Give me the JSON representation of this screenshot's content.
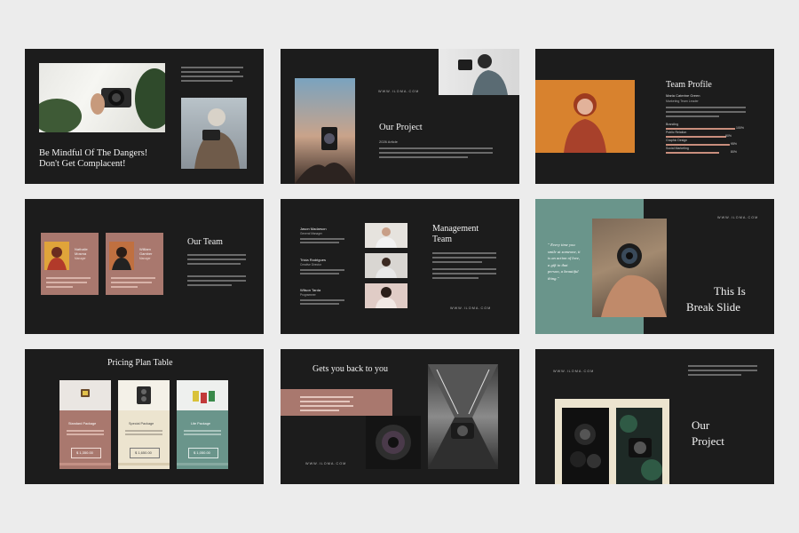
{
  "slides": {
    "s1": {
      "title_line1": "Be Mindful Of The Dangers!",
      "title_line2": "Don't Get Complacent!"
    },
    "s2": {
      "website": "WWW.ILOMA.COM",
      "title": "Our Project",
      "subtitle": "2026 Article"
    },
    "s3": {
      "title": "Team Profile",
      "name": "Maria Caterine Green",
      "role": "Marketing Team Leader",
      "skills": [
        {
          "label": "Branding",
          "percent": "100%",
          "value": 1.0
        },
        {
          "label": "Public Relation",
          "percent": "90%",
          "value": 0.9
        },
        {
          "label": "Graphic Design",
          "percent": "95%",
          "value": 0.95
        },
        {
          "label": "Social Marketing",
          "percent": "80%",
          "value": 0.8
        }
      ]
    },
    "s4": {
      "title": "Our Team",
      "members": [
        {
          "name_line1": "Nathalie",
          "name_line2": "Mosma",
          "role": "Manager"
        },
        {
          "name_line1": "William",
          "name_line2": "Gamber",
          "role": "Manager"
        }
      ]
    },
    "s5": {
      "title_line1": "Management",
      "title_line2": "Team",
      "website": "WWW.ILOMA.COM",
      "members": [
        {
          "name": "Jason Madarson",
          "role": "General Manager"
        },
        {
          "name": "Tricia Rodrigues",
          "role": "Creative Director"
        },
        {
          "name": "Wilson Tarda",
          "role": "Programmer"
        }
      ]
    },
    "s6": {
      "website": "WWW.ILOMA.COM",
      "quote": [
        "\" Every time you",
        "smile at someone, it",
        "is an action of love,",
        "a gift to that",
        "person, a beautiful",
        "thing.\""
      ],
      "title_line1": "This Is",
      "title_line2": "Break Slide"
    },
    "s7": {
      "title": "Pricing Plan Table",
      "plans": [
        {
          "name": "Standard Package",
          "price": "$ 1,350.00"
        },
        {
          "name": "Special Package",
          "price": "$ 1,650.00"
        },
        {
          "name": "Lite Package",
          "price": "$ 1,050.00"
        }
      ]
    },
    "s8": {
      "title": "Gets you back to you",
      "website": "WWW.ILOMA.COM"
    },
    "s9": {
      "website": "WWW.ILOMA.COM",
      "title_line1": "Our",
      "title_line2": "Project"
    }
  },
  "colors": {
    "background": "#ececec",
    "slide": "#1c1c1c",
    "rose": "#a9786e",
    "teal": "#6a958b",
    "cream": "#ece4cf",
    "orange": "#d8822e"
  }
}
